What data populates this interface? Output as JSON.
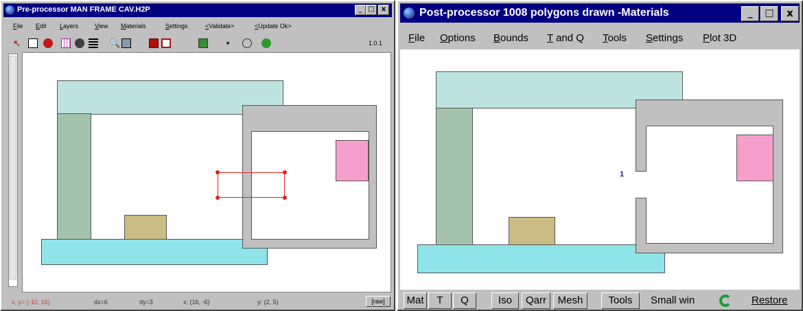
{
  "pre": {
    "title": "Pre-processor  MAN FRAME CAV.H2P",
    "menu": [
      "File",
      "Edit",
      "Layers",
      "View",
      "Materials",
      "Settings",
      "<Validate>",
      "<Update Ok>"
    ],
    "toolbar_version": "1.0.1",
    "status": {
      "coords": "x, y= (-10, 16)",
      "dx": "dx=6",
      "dy": "dy=3",
      "x_range": "x: (16, -6)",
      "y_range": "y: (2, 5)",
      "button": "[raw]"
    }
  },
  "post": {
    "title": "Post-processor 1008 polygons drawn -Materials",
    "menu": [
      "File",
      "Options",
      "Bounds",
      "T and Q",
      "Tools",
      "Settings",
      "Plot 3D"
    ],
    "marker": "1",
    "buttons": [
      "Mat",
      "T",
      "Q",
      "Iso",
      "Qarr",
      "Mesh",
      "Tools"
    ],
    "small_win": "Small win",
    "restore": "Restore"
  },
  "window_buttons": {
    "minimize": "_",
    "maximize": "□",
    "close": "x"
  },
  "colors": {
    "title_active": "#000080",
    "material_light_cyan": "#bde3e1",
    "material_sage": "#a4c3ac",
    "material_tan": "#c9bc85",
    "material_cyan": "#8ee4e9",
    "material_grey": "#c0c0c0",
    "material_pink": "#f5a0cc",
    "selection_red": "#e02020"
  }
}
